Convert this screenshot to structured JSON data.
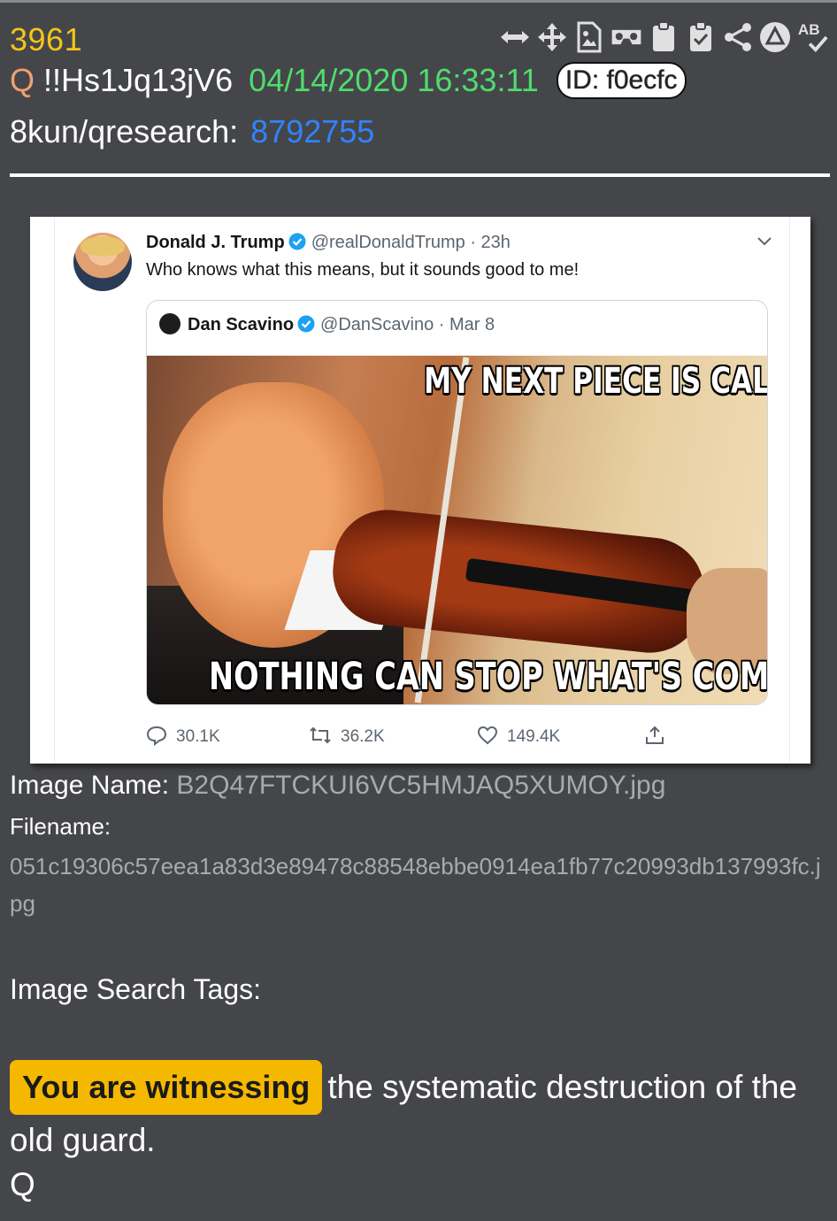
{
  "post": {
    "number": "3961",
    "q_marker": "Q",
    "tripcode": "!!Hs1Jq13jV6",
    "datetime": "04/14/2020 16:33:11",
    "id_badge": "ID: f0ecfc",
    "board": "8kun/qresearch:",
    "post_link": "8792755"
  },
  "toolbar": {
    "icons": [
      "expand-horizontal-icon",
      "move-icon",
      "image-file-icon",
      "vr-goggles-icon",
      "clipboard-icon",
      "clipboard-check-icon",
      "share-icon",
      "triangle-circle-icon",
      "spellcheck-icon"
    ]
  },
  "tweet": {
    "author_name": "Donald J. Trump",
    "author_handle": "@realDonaldTrump · 23h",
    "text": "Who knows what this means, but it sounds good to me!",
    "quoted": {
      "name": "Dan Scavino",
      "handle": "@DanScavino · Mar 8",
      "meme_top": "MY NEXT PIECE IS CALLED",
      "meme_bottom": "NOTHING CAN STOP WHAT'S COMING"
    },
    "replies": "30.1K",
    "retweets": "36.2K",
    "likes": "149.4K",
    "verified_color": "#1da1f2"
  },
  "meta": {
    "image_name_label": "Image Name:",
    "image_name": "B2Q47FTCKUI6VC5HMJAQ5XUMOY.jpg",
    "filename_label": "Filename:",
    "filename": "051c19306c57eea1a83d3e89478c88548ebbe0914ea1fb77c20993db137993fc.jpg",
    "search_tags_label": "Image Search Tags:"
  },
  "message": {
    "highlight": "You are witnessing",
    "rest": "the systematic destruction of the old guard.",
    "signature": "Q"
  },
  "colors": {
    "background": "#45464a",
    "post_number": "#f5c518",
    "datetime": "#4fdd6e",
    "link": "#2f84ff",
    "highlight": "#f5b800"
  }
}
